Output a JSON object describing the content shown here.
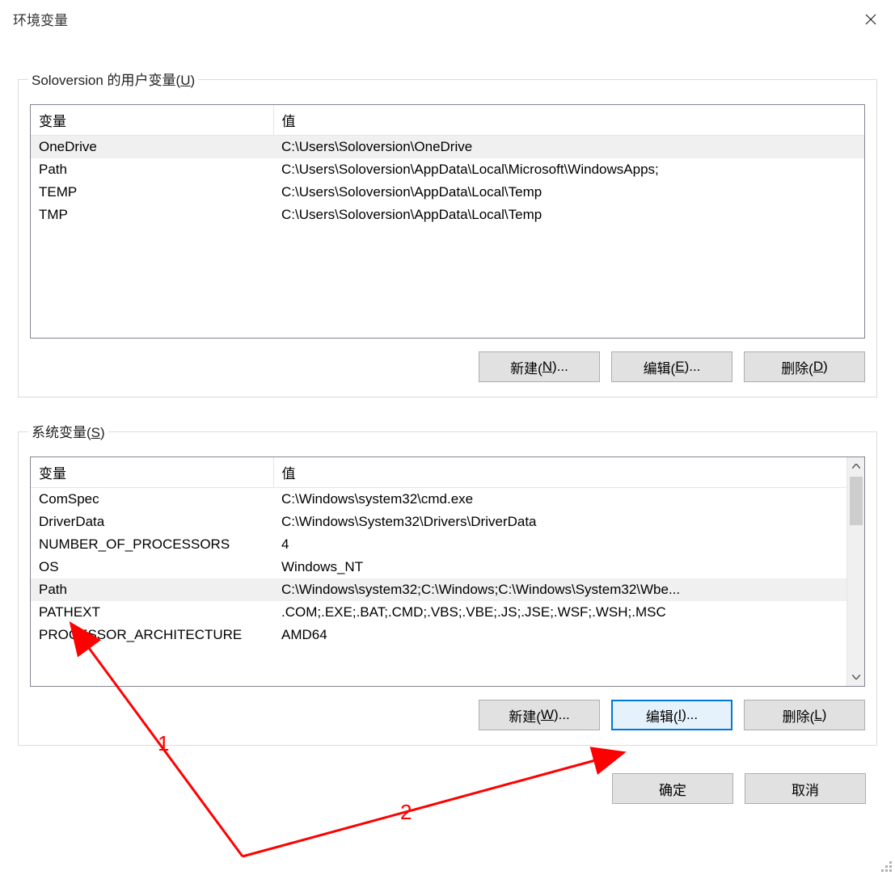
{
  "window": {
    "title": "环境变量"
  },
  "user_section": {
    "legend_prefix": "Soloversion 的用户变量(",
    "legend_key": "U",
    "legend_suffix": ")",
    "headers": {
      "var": "变量",
      "val": "值"
    },
    "rows": [
      {
        "name": "OneDrive",
        "value": "C:\\Users\\Soloversion\\OneDrive",
        "selected": true
      },
      {
        "name": "Path",
        "value": "C:\\Users\\Soloversion\\AppData\\Local\\Microsoft\\WindowsApps;",
        "selected": false
      },
      {
        "name": "TEMP",
        "value": "C:\\Users\\Soloversion\\AppData\\Local\\Temp",
        "selected": false
      },
      {
        "name": "TMP",
        "value": "C:\\Users\\Soloversion\\AppData\\Local\\Temp",
        "selected": false
      }
    ],
    "buttons": {
      "new": {
        "prefix": "新建(",
        "key": "N",
        "suffix": ")..."
      },
      "edit": {
        "prefix": "编辑(",
        "key": "E",
        "suffix": ")..."
      },
      "delete": {
        "prefix": "删除(",
        "key": "D",
        "suffix": ")"
      }
    }
  },
  "system_section": {
    "legend_prefix": "系统变量(",
    "legend_key": "S",
    "legend_suffix": ")",
    "headers": {
      "var": "变量",
      "val": "值"
    },
    "rows": [
      {
        "name": "ComSpec",
        "value": "C:\\Windows\\system32\\cmd.exe",
        "selected": false
      },
      {
        "name": "DriverData",
        "value": "C:\\Windows\\System32\\Drivers\\DriverData",
        "selected": false
      },
      {
        "name": "NUMBER_OF_PROCESSORS",
        "value": "4",
        "selected": false
      },
      {
        "name": "OS",
        "value": "Windows_NT",
        "selected": false
      },
      {
        "name": "Path",
        "value": "C:\\Windows\\system32;C:\\Windows;C:\\Windows\\System32\\Wbe...",
        "selected": true
      },
      {
        "name": "PATHEXT",
        "value": ".COM;.EXE;.BAT;.CMD;.VBS;.VBE;.JS;.JSE;.WSF;.WSH;.MSC",
        "selected": false
      },
      {
        "name": "PROCESSOR_ARCHITECTURE",
        "value": "AMD64",
        "selected": false
      }
    ],
    "buttons": {
      "new": {
        "prefix": "新建(",
        "key": "W",
        "suffix": ")..."
      },
      "edit": {
        "prefix": "编辑(",
        "key": "I",
        "suffix": ")..."
      },
      "delete": {
        "prefix": "删除(",
        "key": "L",
        "suffix": ")"
      }
    }
  },
  "footer": {
    "ok": "确定",
    "cancel": "取消"
  },
  "annotations": {
    "label1": "1",
    "label2": "2"
  }
}
